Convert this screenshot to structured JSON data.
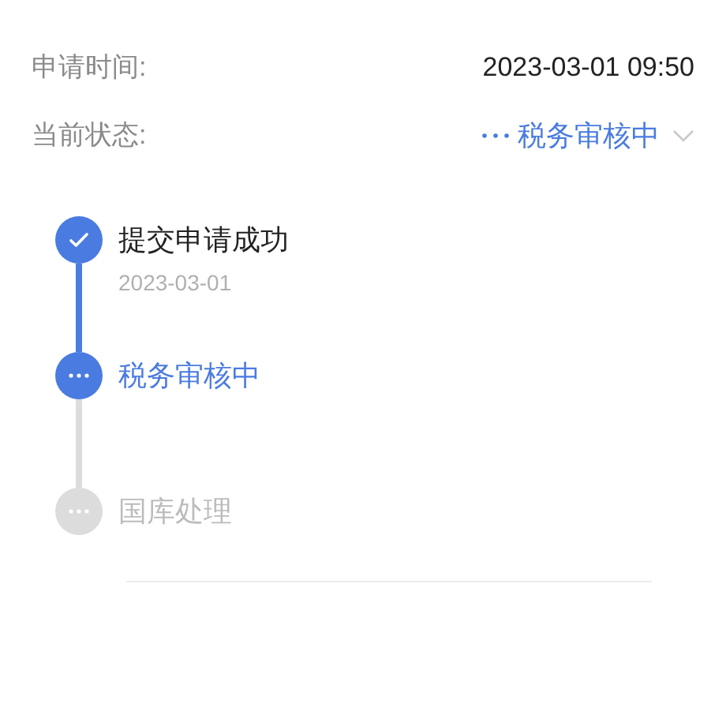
{
  "info_rows": [
    {
      "label": "申请时间:",
      "value": "2023-03-01 09:50",
      "kind": "text"
    },
    {
      "label": "当前状态:",
      "value": "税务审核中",
      "kind": "status"
    }
  ],
  "steps": [
    {
      "title": "提交申请成功",
      "date": "2023-03-01",
      "kind": "done"
    },
    {
      "title": "税务审核中",
      "kind": "current"
    },
    {
      "title": "国库处理",
      "kind": "pending"
    }
  ]
}
